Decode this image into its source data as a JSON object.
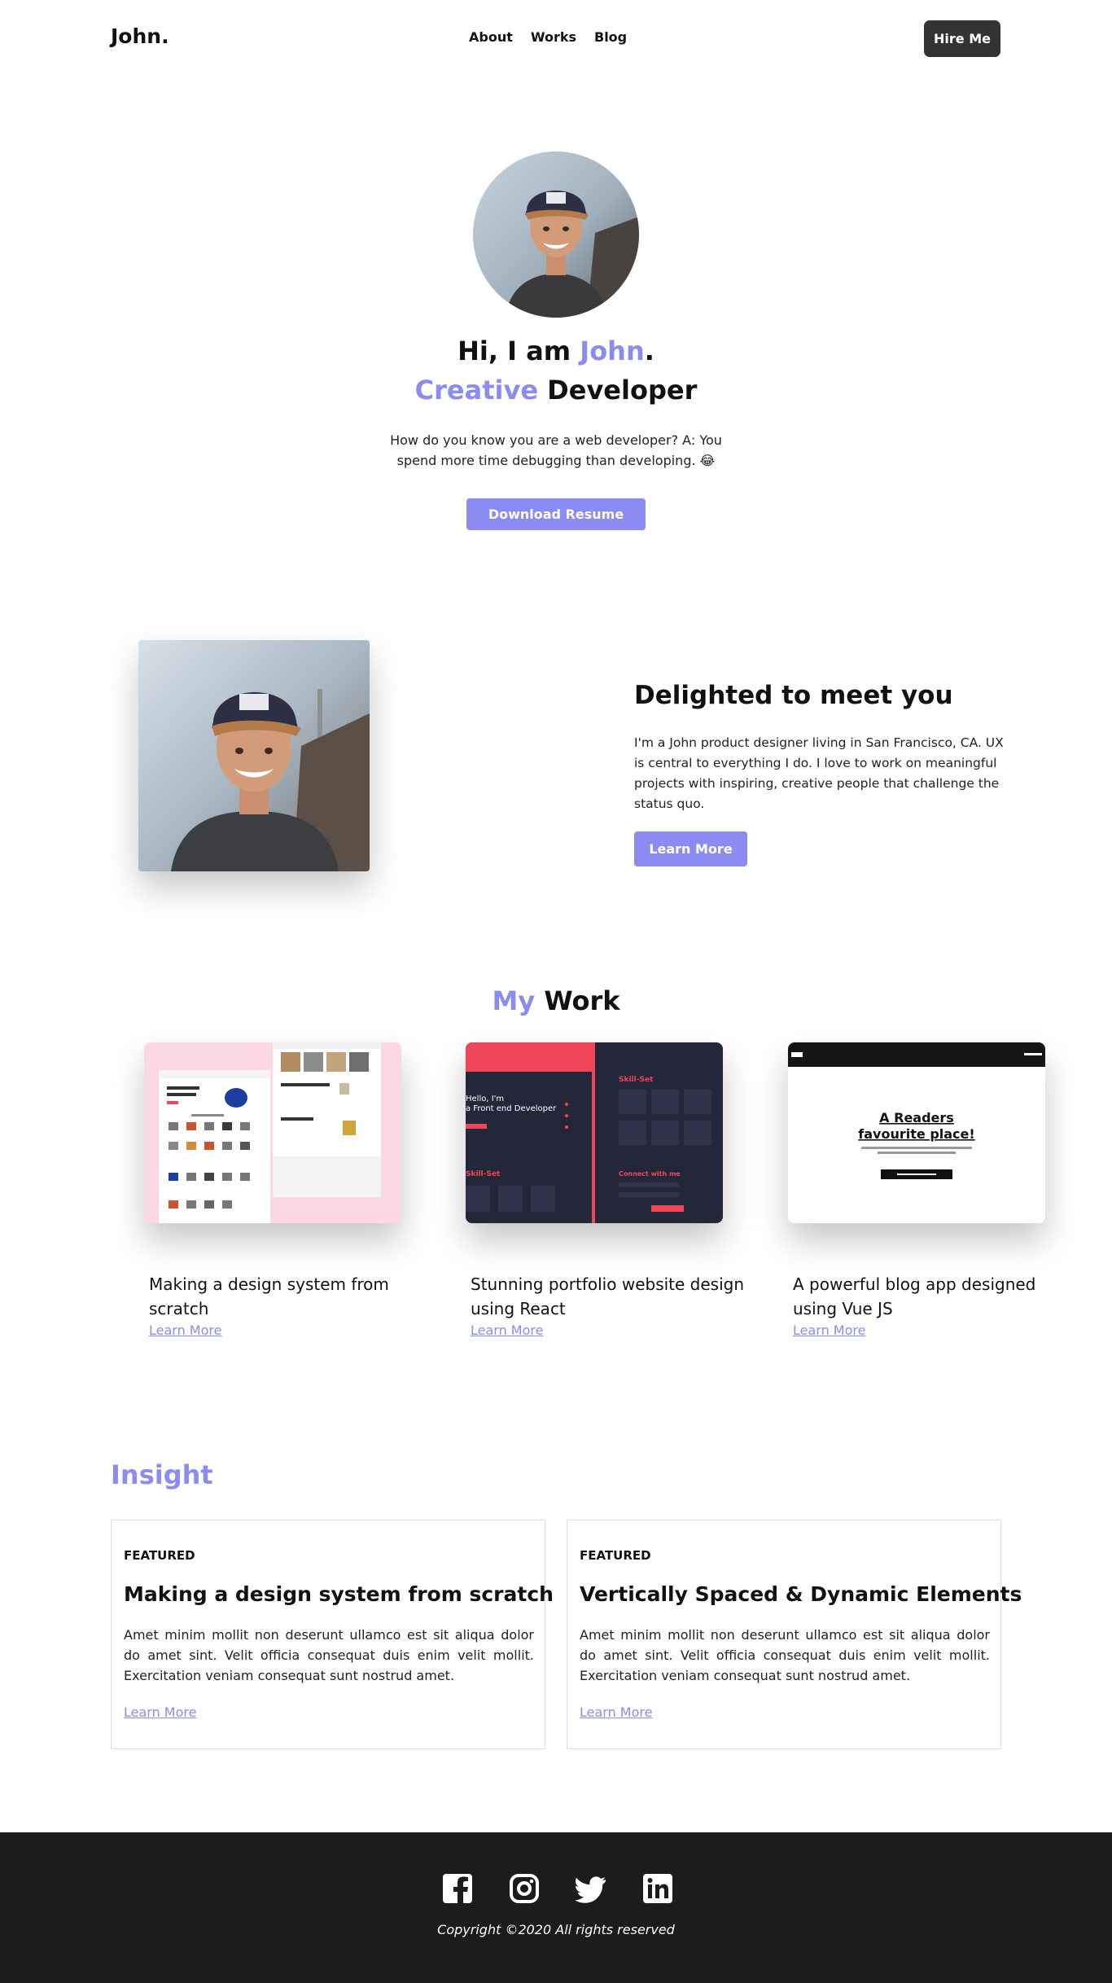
{
  "header": {
    "logo": "John.",
    "nav": [
      "About",
      "Works",
      "Blog"
    ],
    "cta": "Hire Me"
  },
  "hero": {
    "greeting_prefix": "Hi, I am ",
    "name": "John",
    "greeting_suffix": ".",
    "role_accent": "Creative",
    "role_rest": " Developer",
    "description": "How do you know you are a web developer? A: You spend more time debugging than developing. 😂",
    "button": "Download Resume"
  },
  "about": {
    "title": "Delighted to meet you",
    "text": "I'm a John product designer living in San Francisco, CA. UX is central to everything I do. I love to work on meaningful projects with inspiring, creative people that challenge the status quo.",
    "button": "Learn More"
  },
  "works": {
    "title_accent": "My",
    "title_rest": " Work",
    "items": [
      {
        "title": "Making a design system from scratch",
        "link": "Learn More"
      },
      {
        "title": "Stunning portfolio website design using React",
        "link": "Learn More"
      },
      {
        "title": "A powerful blog app designed using Vue JS",
        "link": "Learn More"
      }
    ],
    "thumb2": {
      "hero_text": "Hello, I'm\na Front end Developer",
      "section1": "Skill-Set",
      "section2": "Connect with me"
    },
    "thumb3": {
      "headline": "A Readers favourite place!",
      "sub": "We provide high quality online resource for reading blogs. Just sign up and start reading some quality blogs.",
      "button": "Login with Google"
    }
  },
  "insight": {
    "title": "Insight",
    "posts": [
      {
        "tag": "FEATURED",
        "title": "Making a design system from scratch",
        "text": "Amet minim mollit non deserunt ullamco est sit aliqua dolor do amet sint. Velit officia consequat duis enim velit mollit. Exercitation veniam consequat sunt nostrud amet.",
        "link": "Learn More"
      },
      {
        "tag": "FEATURED",
        "title": "Vertically Spaced & Dynamic Elements",
        "text": "Amet minim mollit non deserunt ullamco est sit aliqua dolor do amet sint. Velit officia consequat duis enim velit mollit. Exercitation veniam consequat sunt nostrud amet.",
        "link": "Learn More"
      }
    ]
  },
  "footer": {
    "socials": [
      "facebook-icon",
      "instagram-icon",
      "twitter-icon",
      "linkedin-icon"
    ],
    "copyright": "Copyright ©2020 All rights reserved"
  },
  "colors": {
    "accent": "#8b8cf1",
    "dark": "#333333",
    "footer": "#1c1c1c",
    "thumb_red": "#f0465a",
    "thumb_navy": "#24263a"
  }
}
